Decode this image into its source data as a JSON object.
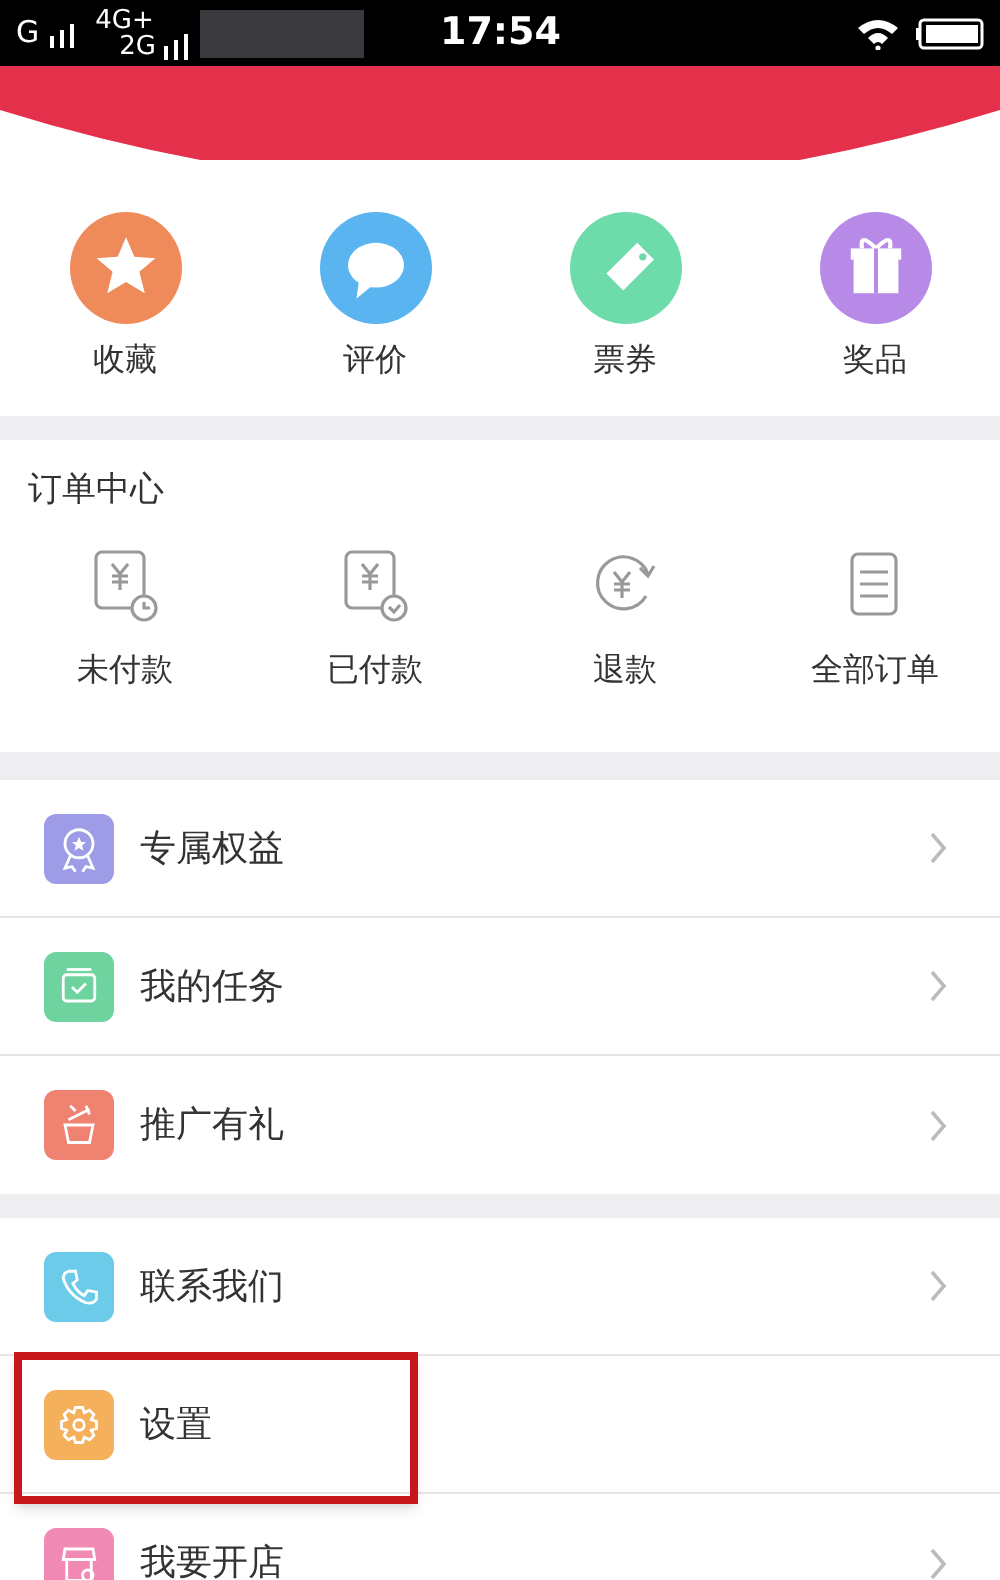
{
  "status_bar": {
    "carrier_1": "G",
    "carrier_2": "4G+",
    "carrier_3": "2G",
    "time": "17:54"
  },
  "quick_actions": [
    {
      "label": "收藏",
      "kind": "star",
      "color": "#ef8a5a"
    },
    {
      "label": "评价",
      "kind": "chat",
      "color": "#5ab4f0"
    },
    {
      "label": "票券",
      "kind": "tag",
      "color": "#6ddcaa"
    },
    {
      "label": "奖品",
      "kind": "gift",
      "color": "#b88ae8"
    }
  ],
  "order_center": {
    "title": "订单中心",
    "items": [
      {
        "label": "未付款",
        "kind": "unpaid"
      },
      {
        "label": "已付款",
        "kind": "paid"
      },
      {
        "label": "退款",
        "kind": "refund"
      },
      {
        "label": "全部订单",
        "kind": "all"
      }
    ]
  },
  "menu_groups": [
    [
      {
        "label": "专属权益",
        "kind": "badge",
        "color": "#9e9ce6",
        "chevron": true,
        "highlighted": false
      },
      {
        "label": "我的任务",
        "kind": "task",
        "color": "#6fd3a0",
        "chevron": true,
        "highlighted": false
      },
      {
        "label": "推广有礼",
        "kind": "promo",
        "color": "#f08272",
        "chevron": true,
        "highlighted": false
      }
    ],
    [
      {
        "label": "联系我们",
        "kind": "phone",
        "color": "#6ccbe8",
        "chevron": true,
        "highlighted": false
      },
      {
        "label": "设置",
        "kind": "gear",
        "color": "#f5b05c",
        "chevron": false,
        "highlighted": true
      },
      {
        "label": "我要开店",
        "kind": "shop",
        "color": "#f08ab4",
        "chevron": true,
        "highlighted": false
      }
    ]
  ]
}
